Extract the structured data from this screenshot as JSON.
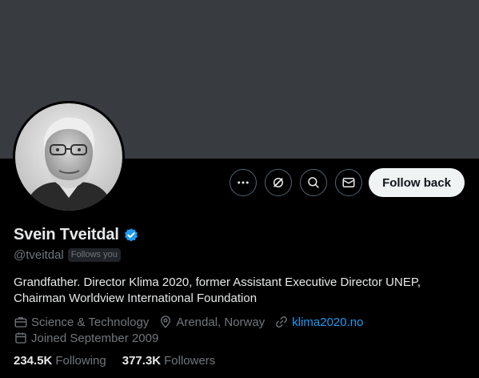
{
  "profile": {
    "display_name": "Svein Tveitdal",
    "handle": "@tveitdal",
    "follows_you": "Follows you",
    "bio": "Grandfather. Director Klima 2020, former Assistant Executive Director UNEP, Chairman Worldview International Foundation",
    "category": "Science & Technology",
    "location": "Arendal, Norway",
    "website": "klima2020.no",
    "joined": "Joined September 2009",
    "following_count": "234.5K",
    "following_label": "Following",
    "followers_count": "377.3K",
    "followers_label": "Followers"
  },
  "actions": {
    "follow_label": "Follow back",
    "icons": [
      "more-icon",
      "grok-icon",
      "search-icon",
      "message-icon"
    ]
  },
  "colors": {
    "background": "#000000",
    "banner": "#383b40",
    "link": "#1d9bf0",
    "verified": "#1d9bf0",
    "secondary_text": "#71767b"
  }
}
